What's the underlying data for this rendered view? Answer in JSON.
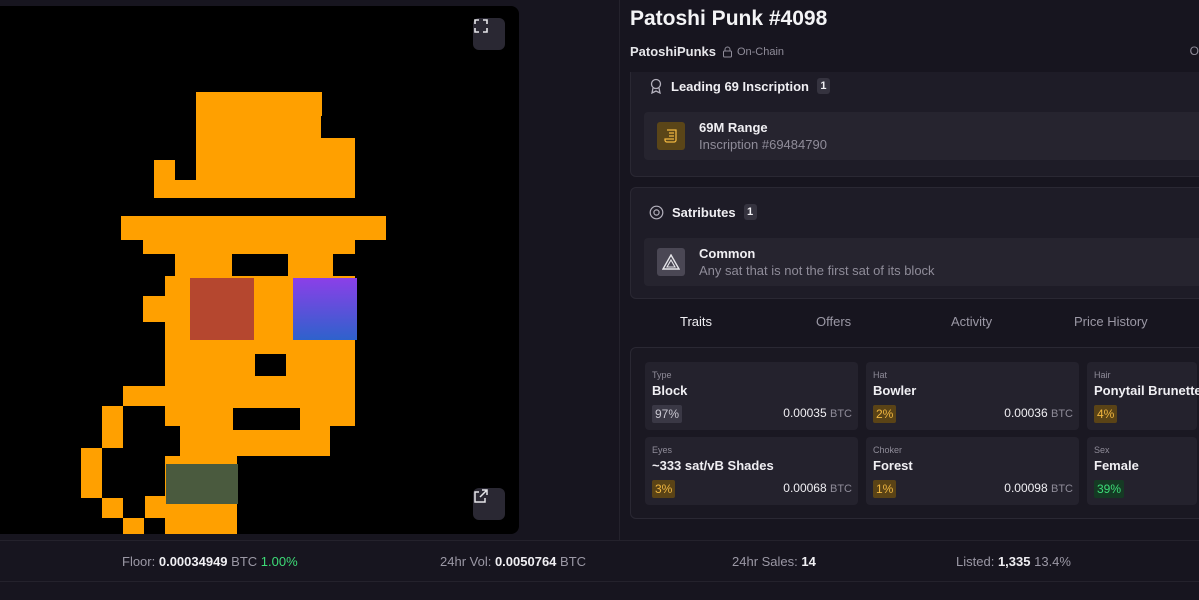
{
  "item": {
    "title": "Patoshi Punk #4098",
    "collection": "PatoshiPunks",
    "onchain_label": "On-Chain",
    "edge_glyph": "O"
  },
  "inscription": {
    "header": "Leading 69 Inscription",
    "count": "1",
    "icon": "scroll-icon",
    "title": "69M Range",
    "subtitle": "Inscription #69484790"
  },
  "satributes": {
    "header": "Satributes",
    "count": "1",
    "icon": "triangle-icon",
    "title": "Common",
    "subtitle": "Any sat that is not the first sat of its block"
  },
  "tabs": [
    {
      "label": "Traits",
      "active": true
    },
    {
      "label": "Offers",
      "active": false
    },
    {
      "label": "Activity",
      "active": false
    },
    {
      "label": "Price History",
      "active": false
    }
  ],
  "traits": [
    {
      "type": "Type",
      "value": "Block",
      "pct": "97%",
      "pct_color": "grey",
      "price": "0.00035",
      "unit": "BTC"
    },
    {
      "type": "Hat",
      "value": "Bowler",
      "pct": "2%",
      "pct_color": "amber",
      "price": "0.00036",
      "unit": "BTC"
    },
    {
      "type": "Hair",
      "value": "Ponytail Brunette",
      "pct": "4%",
      "pct_color": "amber",
      "price": "",
      "unit": ""
    },
    {
      "type": "Eyes",
      "value": "~333 sat/vB Shades",
      "pct": "3%",
      "pct_color": "amber",
      "price": "0.00068",
      "unit": "BTC"
    },
    {
      "type": "Choker",
      "value": "Forest",
      "pct": "1%",
      "pct_color": "amber",
      "price": "0.00098",
      "unit": "BTC"
    },
    {
      "type": "Sex",
      "value": "Female",
      "pct": "39%",
      "pct_color": "green",
      "price": "",
      "unit": ""
    }
  ],
  "stats": {
    "floor_label": "Floor:",
    "floor_value": "0.00034949",
    "floor_unit": "BTC",
    "floor_change": "1.00%",
    "vol_label": "24hr Vol:",
    "vol_value": "0.0050764",
    "vol_unit": "BTC",
    "sales_label": "24hr Sales:",
    "sales_value": "14",
    "listed_label": "Listed:",
    "listed_value": "1,335",
    "listed_pct": "13.4%"
  },
  "colors": {
    "punk_orange": "#ffa000",
    "lens_red": "#b5472f",
    "lens_violet_top": "#8b3fe8",
    "lens_blue_bottom": "#2e62cc",
    "choker_green": "#4a5a3e",
    "positive_green": "#3ddc77"
  }
}
